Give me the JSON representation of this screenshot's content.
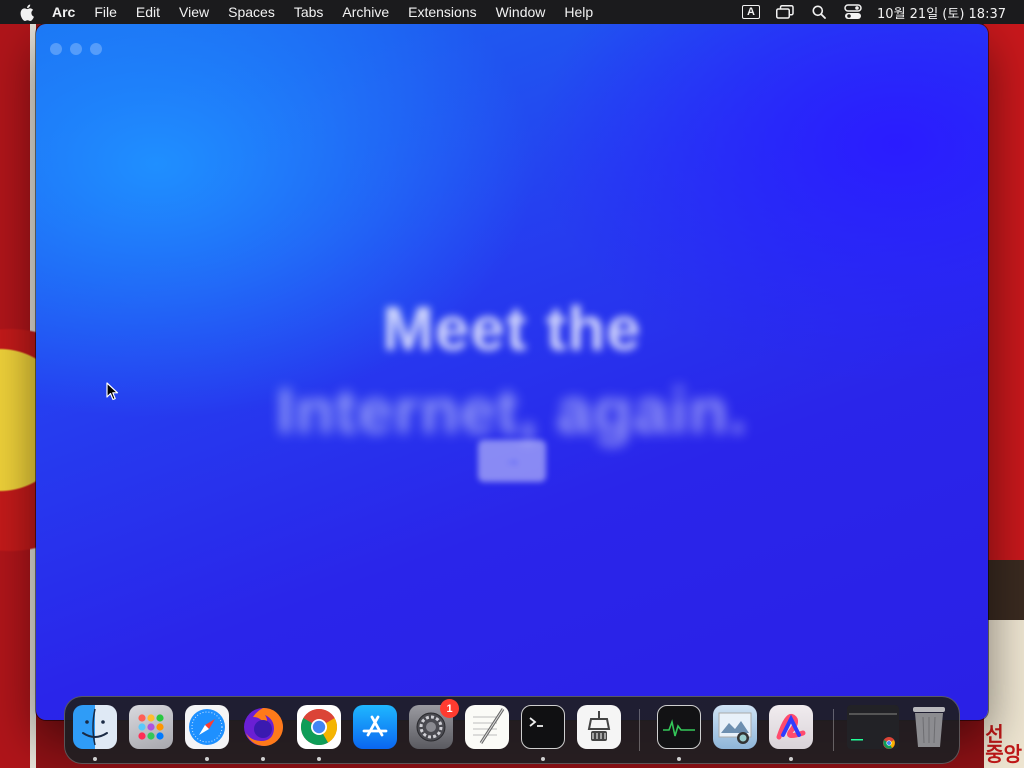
{
  "menubar": {
    "app_name": "Arc",
    "items": [
      "File",
      "Edit",
      "View",
      "Spaces",
      "Tabs",
      "Archive",
      "Extensions",
      "Window",
      "Help"
    ],
    "input_source": "A",
    "clock": "10월 21일 (토) 18:37"
  },
  "window": {
    "hero_line1": "Meet the",
    "hero_line2": "Internet, again.",
    "hero_button": "→"
  },
  "dock": {
    "apps": [
      {
        "icon": "finder-icon",
        "running": true
      },
      {
        "icon": "launchpad-icon",
        "running": false
      },
      {
        "icon": "safari-icon",
        "running": true
      },
      {
        "icon": "firefox-icon",
        "running": true
      },
      {
        "icon": "chrome-icon",
        "running": true
      },
      {
        "icon": "app-store-icon",
        "running": false
      },
      {
        "icon": "system-settings-icon",
        "running": false,
        "badge": "1"
      },
      {
        "icon": "textedit-icon",
        "running": false
      },
      {
        "icon": "terminal-icon",
        "running": true
      },
      {
        "icon": "automator-icon",
        "running": false
      },
      {
        "icon": "activity-monitor-icon",
        "running": true
      },
      {
        "icon": "preview-icon",
        "running": false
      },
      {
        "icon": "arc-icon",
        "running": true
      }
    ],
    "others": [
      "chrome-window-thumbnail",
      "trash-icon"
    ]
  },
  "wallpaper": {
    "corner_text": "선\n중앙"
  },
  "colors": {
    "menubar_bg": "#1b1b1d",
    "window_blue": "#2a25ea",
    "badge_red": "#ff3b30"
  }
}
